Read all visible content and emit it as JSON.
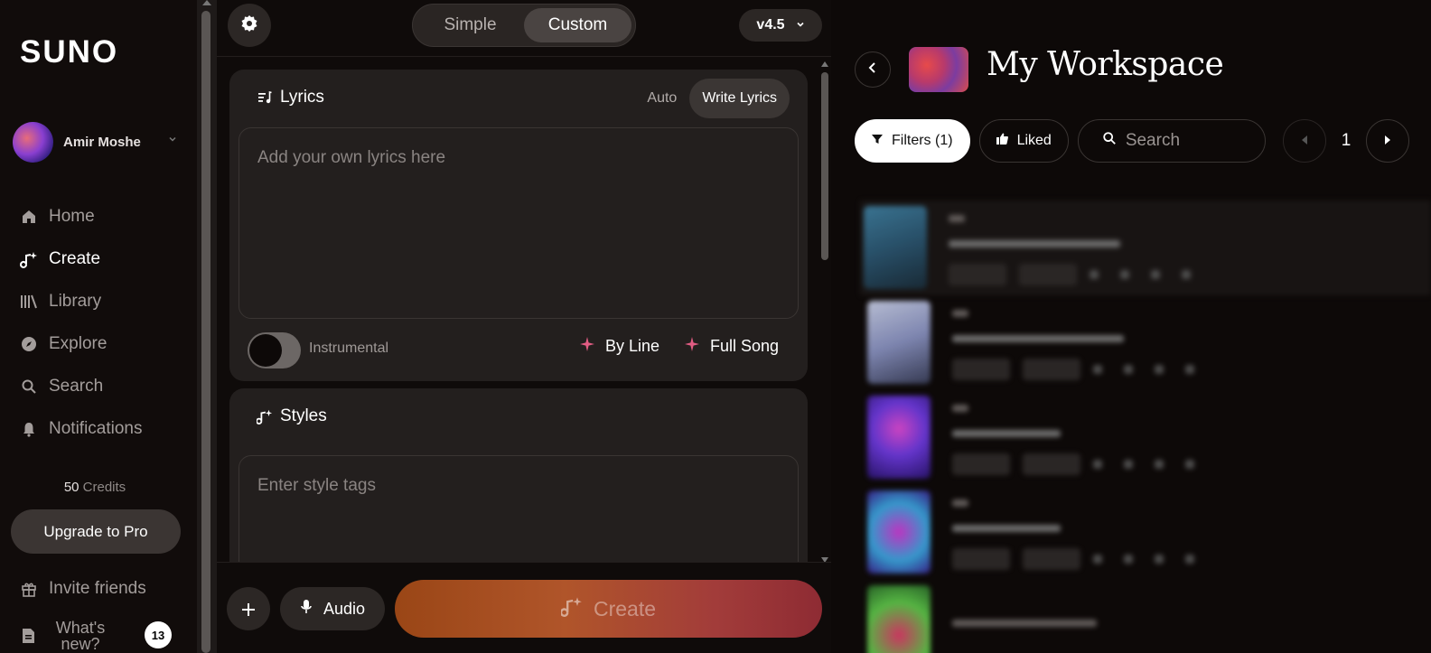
{
  "app": {
    "logo": "SUNO"
  },
  "user": {
    "name": "Amir Moshe"
  },
  "nav": [
    {
      "label": "Home",
      "icon": "home-icon"
    },
    {
      "label": "Create",
      "icon": "music-sparkle-icon"
    },
    {
      "label": "Library",
      "icon": "library-icon"
    },
    {
      "label": "Explore",
      "icon": "compass-icon"
    },
    {
      "label": "Search",
      "icon": "search-icon"
    },
    {
      "label": "Notifications",
      "icon": "bell-icon"
    }
  ],
  "credits": {
    "amount": "50",
    "label": "Credits"
  },
  "upgrade_label": "Upgrade to Pro",
  "invite_label": "Invite friends",
  "whats_new": {
    "label": "What's new?",
    "count": "13"
  },
  "create_panel": {
    "modes": [
      "Simple",
      "Custom"
    ],
    "active_mode": "Custom",
    "version": "v4.5",
    "lyrics": {
      "title": "Lyrics",
      "tabs": [
        "Auto",
        "Write Lyrics"
      ],
      "active_tab": "Write Lyrics",
      "placeholder": "Add your own lyrics here",
      "instrumental_label": "Instrumental",
      "instrumental_on": false,
      "by_line_label": "By Line",
      "full_song_label": "Full Song"
    },
    "styles": {
      "title": "Styles",
      "placeholder": "Enter style tags"
    },
    "audio_label": "Audio",
    "create_label": "Create"
  },
  "workspace": {
    "title": "My Workspace",
    "filters_label": "Filters (1)",
    "liked_label": "Liked",
    "search_placeholder": "Search",
    "page": "1"
  },
  "colors": {
    "accent_pink": "#e25c83",
    "create_gradient_start": "#9a4616",
    "create_gradient_end": "#8e2b33"
  }
}
